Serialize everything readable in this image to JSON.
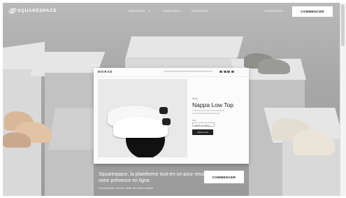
{
  "nav": {
    "logo_text": "SQUARESPACE",
    "links": [
      "PRODUITS",
      "TEMPLATES",
      "EXEMPLES"
    ],
    "products_caret": "∨",
    "login": "CONNEXION",
    "cta": "COMMENCER"
  },
  "preview": {
    "brand": "MORSE",
    "product_label": "Shop",
    "product_title": "Nappa Low Top",
    "size_label": "Size",
    "size_select": "Select an option",
    "add_button": "Add to Cart"
  },
  "hero": {
    "headline": "Squarespace, la plateforme tout-en-un pour réussir votre présence en ligne.",
    "subline": "Essai gratuit. Aucune carte de crédit requise.",
    "cta": "COMMENCER"
  },
  "colors": {
    "background": "#a8a8a8",
    "button_bg": "#ffffff",
    "button_text": "#111111",
    "preview_button": "#222222"
  }
}
